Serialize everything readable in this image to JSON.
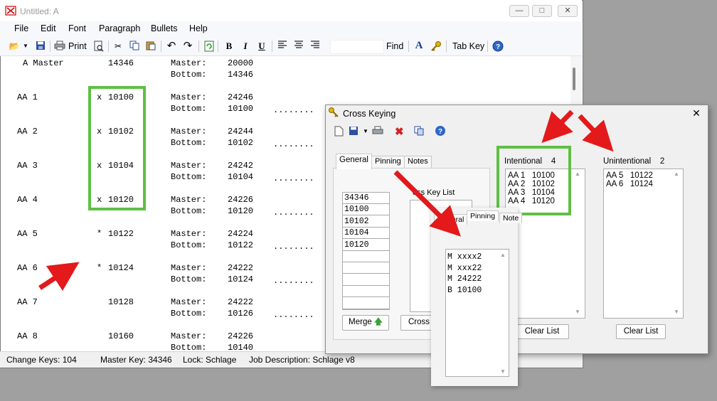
{
  "window": {
    "title": "Untitled: A"
  },
  "menu": [
    "File",
    "Edit",
    "Font",
    "Paragraph",
    "Bullets",
    "Help"
  ],
  "toolbar": {
    "print_label": "Print",
    "find_label": "Find",
    "tabkey_label": "Tab Key",
    "bold": "B",
    "italic": "I",
    "underline": "U",
    "font_a": "A"
  },
  "document": {
    "header": {
      "name": "A Master",
      "code": "14346",
      "master_label": "Master:",
      "master_value": "20000",
      "bottom_label": "Bottom:",
      "bottom_value": "14346"
    },
    "rows": [
      {
        "name": "AA 1",
        "mark": "x",
        "code": "10100",
        "master_label": "Master:",
        "master_value": "24246",
        "bottom_label": "Bottom:",
        "bottom_value": "10100",
        "dots": "........"
      },
      {
        "name": "AA 2",
        "mark": "x",
        "code": "10102",
        "master_label": "Master:",
        "master_value": "24244",
        "bottom_label": "Bottom:",
        "bottom_value": "10102",
        "dots": "........"
      },
      {
        "name": "AA 3",
        "mark": "x",
        "code": "10104",
        "master_label": "Master:",
        "master_value": "24242",
        "bottom_label": "Bottom:",
        "bottom_value": "10104",
        "dots": "........"
      },
      {
        "name": "AA 4",
        "mark": "x",
        "code": "10120",
        "master_label": "Master:",
        "master_value": "24226",
        "bottom_label": "Bottom:",
        "bottom_value": "10120",
        "dots": "........"
      },
      {
        "name": "AA 5",
        "mark": "*",
        "code": "10122",
        "master_label": "Master:",
        "master_value": "24224",
        "bottom_label": "Bottom:",
        "bottom_value": "10122",
        "dots": "........"
      },
      {
        "name": "AA 6",
        "mark": "*",
        "code": "10124",
        "master_label": "Master:",
        "master_value": "24222",
        "bottom_label": "Bottom:",
        "bottom_value": "10124",
        "dots": "........"
      },
      {
        "name": "AA 7",
        "mark": "",
        "code": "10128",
        "master_label": "Master:",
        "master_value": "24222",
        "bottom_label": "Bottom:",
        "bottom_value": "10126",
        "dots": "........"
      },
      {
        "name": "AA 8",
        "mark": "",
        "code": "10160",
        "master_label": "Master:",
        "master_value": "24226",
        "bottom_label": "Bottom:",
        "bottom_value": "10140",
        "dots": "........"
      }
    ]
  },
  "status": {
    "change_keys": "Change Keys:  104",
    "master_key": "Master Key: 34346",
    "lock": "Lock: Schlage",
    "job": "Job Description: Schlage v8"
  },
  "dialog": {
    "title": "Cross Keying",
    "tabs": [
      "General",
      "Pinning",
      "Notes"
    ],
    "key_list": [
      "34346",
      "10100",
      "10102",
      "10104",
      "10120",
      "",
      "",
      "",
      "",
      ""
    ],
    "cross_key_list_label": "Cross Key List",
    "cross_key_list_label_visible": "oss Key List",
    "merge_button": "Merge",
    "cross_button": "Cross",
    "intentional": {
      "label": "Intentional",
      "count": "4",
      "items": [
        "AA 1   10100",
        "AA 2   10102",
        "AA 3   10104",
        "AA 4   10120"
      ]
    },
    "unintentional": {
      "label": "Unintentional",
      "count": "2",
      "items": [
        "AA 5   10122",
        "AA 6   10124"
      ]
    },
    "clear_list_button": "Clear List"
  },
  "pinning_popup": {
    "tabs": [
      "General",
      "Pinning",
      "Notes"
    ],
    "tabs_visible": [
      "General",
      "Pinning",
      "Note"
    ],
    "lines": [
      "M xxxx2",
      "M xxx22",
      "M 24222",
      "B 10100"
    ]
  },
  "colors": {
    "highlight_green": "#5fbf45",
    "arrow_red": "#e3191b",
    "title_gray": "#9a9a9a"
  }
}
